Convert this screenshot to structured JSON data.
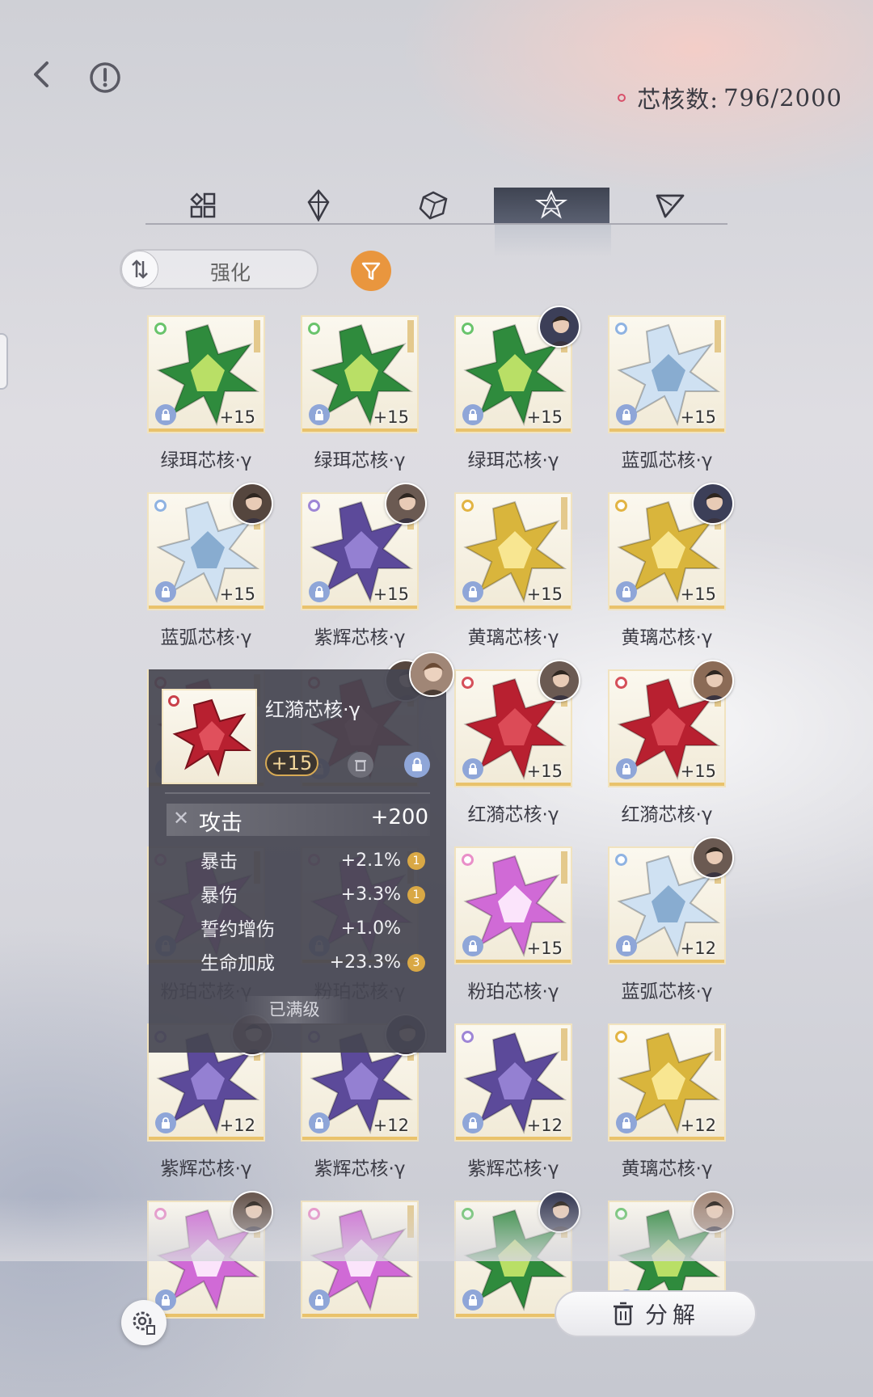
{
  "header": {
    "core_count_label": "芯核数:",
    "core_count_value": "796/2000"
  },
  "tabs": [
    "all-icon",
    "diamond-icon",
    "cube-icon",
    "star-cluster-icon",
    "triangle-icon"
  ],
  "active_tab": 3,
  "sort": {
    "label": "强化"
  },
  "colors": {
    "accent_filter": "#e9963e",
    "green": "#2f8b3d",
    "blue": "#9fc3e6",
    "purple": "#5c4a9a",
    "gold": "#d9b53c",
    "red": "#b82030",
    "pink": "#e26ad6"
  },
  "cards": [
    {
      "name": "绿珥芯核·γ",
      "level": "+15",
      "color": "green",
      "avatar": false
    },
    {
      "name": "绿珥芯核·γ",
      "level": "+15",
      "color": "green",
      "avatar": false
    },
    {
      "name": "绿珥芯核·γ",
      "level": "+15",
      "color": "green",
      "avatar": true
    },
    {
      "name": "蓝弧芯核·γ",
      "level": "+15",
      "color": "blue",
      "avatar": false
    },
    {
      "name": "蓝弧芯核·γ",
      "level": "+15",
      "color": "blue",
      "avatar": true
    },
    {
      "name": "紫辉芯核·γ",
      "level": "+15",
      "color": "purple",
      "avatar": true
    },
    {
      "name": "黄璃芯核·γ",
      "level": "+15",
      "color": "gold",
      "avatar": false
    },
    {
      "name": "黄璃芯核·γ",
      "level": "+15",
      "color": "gold",
      "avatar": true
    },
    {
      "name": "",
      "level": "",
      "color": "red",
      "avatar": false
    },
    {
      "name": "",
      "level": "",
      "color": "red",
      "avatar": true
    },
    {
      "name": "红漪芯核·γ",
      "level": "+15",
      "color": "red",
      "avatar": true
    },
    {
      "name": "红漪芯核·γ",
      "level": "+15",
      "color": "red",
      "avatar": true
    },
    {
      "name": "粉珀芯核·γ",
      "level": "",
      "color": "pink",
      "avatar": false
    },
    {
      "name": "粉珀芯核·γ",
      "level": "",
      "color": "pink",
      "avatar": false
    },
    {
      "name": "粉珀芯核·γ",
      "level": "+15",
      "color": "pink",
      "avatar": false
    },
    {
      "name": "蓝弧芯核·γ",
      "level": "+12",
      "color": "blue",
      "avatar": true
    },
    {
      "name": "紫辉芯核·γ",
      "level": "+12",
      "color": "purple",
      "avatar": true
    },
    {
      "name": "紫辉芯核·γ",
      "level": "+12",
      "color": "purple",
      "avatar": true
    },
    {
      "name": "紫辉芯核·γ",
      "level": "+12",
      "color": "purple",
      "avatar": false
    },
    {
      "name": "黄璃芯核·γ",
      "level": "+12",
      "color": "gold",
      "avatar": false
    },
    {
      "name": "",
      "level": "",
      "color": "pink",
      "avatar": true
    },
    {
      "name": "",
      "level": "",
      "color": "pink",
      "avatar": false
    },
    {
      "name": "",
      "level": "",
      "color": "green",
      "avatar": true
    },
    {
      "name": "",
      "level": "",
      "color": "green",
      "avatar": true
    }
  ],
  "popup": {
    "name": "红漪芯核·γ",
    "level": "+15",
    "main_stat": {
      "label": "攻击",
      "value": "+200"
    },
    "sub_stats": [
      {
        "label": "暴击",
        "value": "+2.1%",
        "badge": "1"
      },
      {
        "label": "暴伤",
        "value": "+3.3%",
        "badge": "1"
      },
      {
        "label": "誓约增伤",
        "value": "+1.0%",
        "badge": ""
      },
      {
        "label": "生命加成",
        "value": "+23.3%",
        "badge": "3"
      }
    ],
    "maxed_label": "已满级"
  },
  "footer": {
    "decompose_label": "分解"
  }
}
